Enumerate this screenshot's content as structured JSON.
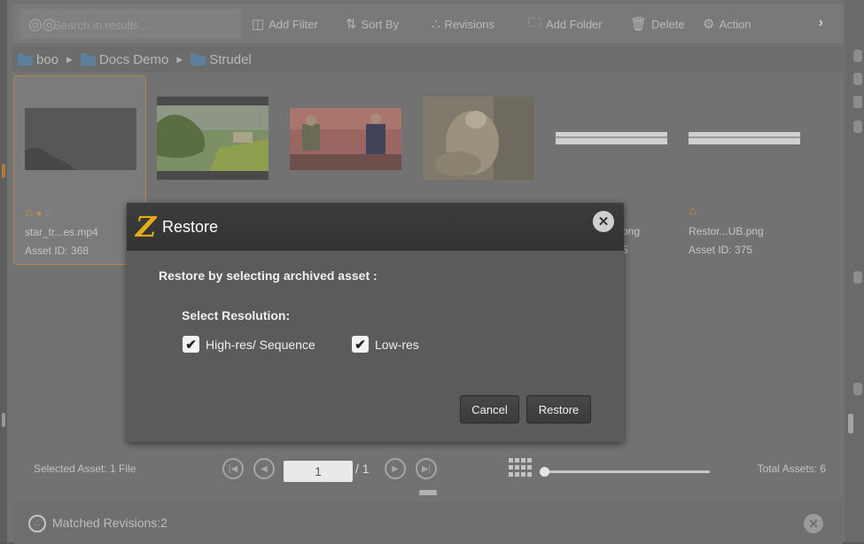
{
  "toolbar": {
    "search_placeholder": "Search in results...",
    "buttons": [
      {
        "label": "Add Filter",
        "icon": "filter-icon"
      },
      {
        "label": "Sort By",
        "icon": "sort-icon"
      },
      {
        "label": "Revisions",
        "icon": "revisions-icon"
      },
      {
        "label": "Add Folder",
        "icon": "add-folder-icon"
      },
      {
        "label": "Delete",
        "icon": "trash-icon"
      },
      {
        "label": "Action",
        "icon": "gear-icon"
      }
    ],
    "more_icon": "chevron-right-icon"
  },
  "breadcrumb": [
    "boo",
    "Docs Demo",
    "Strudel"
  ],
  "assets": [
    {
      "name": "star_tr...es.mp4",
      "id": "Asset ID: 368",
      "selected": true
    },
    {
      "name": "",
      "id": ""
    },
    {
      "name": "",
      "id": ""
    },
    {
      "name": "",
      "id": ""
    },
    {
      "name": "...png",
      "id": "...5"
    },
    {
      "name": "Restor...UB.png",
      "id": "Asset ID: 375"
    }
  ],
  "modal": {
    "title": "Restore",
    "logo": "Z",
    "instruction": "Restore by selecting archived asset :",
    "resolution_label": "Select Resolution:",
    "options": [
      {
        "label": "High-res/ Sequence",
        "checked": true
      },
      {
        "label": "Low-res",
        "checked": true
      }
    ],
    "cancel_label": "Cancel",
    "restore_label": "Restore"
  },
  "footer": {
    "selected": "Selected Asset: 1 File",
    "page_value": "1",
    "page_total": "/ 1",
    "total": "Total Assets: 6"
  },
  "revisions": {
    "label": "Matched Revisions:2"
  },
  "colors": {
    "accent": "#e6aa16",
    "selection_border": "#b4884c",
    "folder": "#5c7f9c"
  }
}
